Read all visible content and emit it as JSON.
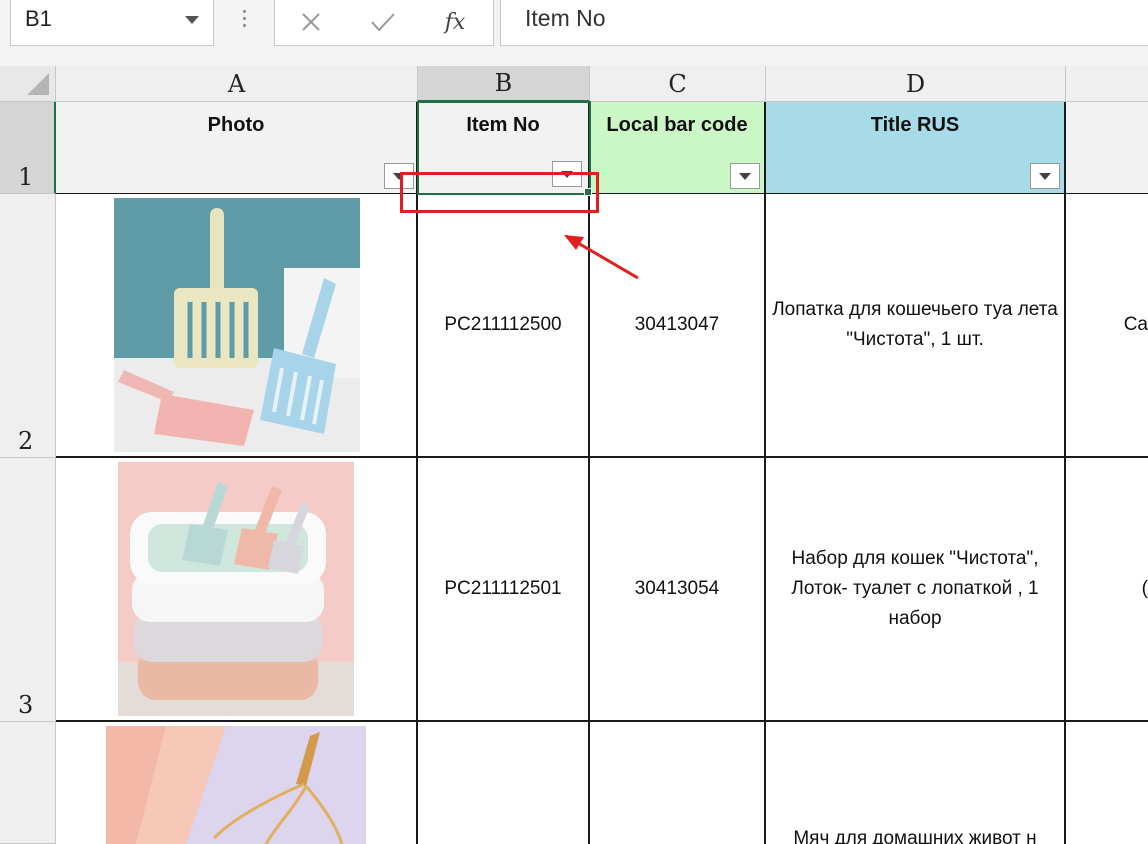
{
  "formula_bar": {
    "name_box": "B1",
    "formula": "Item No",
    "fx_label": "fx",
    "icons": [
      "cancel-x-icon",
      "confirm-check-icon",
      "insert-function-icon"
    ]
  },
  "columns": [
    "A",
    "B",
    "C",
    "D"
  ],
  "rows": [
    "1",
    "2",
    "3"
  ],
  "header": {
    "photo": "Photo",
    "item_no": "Item No",
    "local_bar_code": "Local bar code",
    "title_rus": "Title RUS"
  },
  "data_rows": [
    {
      "item_no": "PC211112500",
      "bar_code": "30413047",
      "title": "Лопатка для кошечьего туа лета \"Чистота\", 1 шт.",
      "partial": "Ca"
    },
    {
      "item_no": "PC211112501",
      "bar_code": "30413054",
      "title": "Набор для кошек \"Чистота\", Лоток- туалет с лопаткой , 1 набор",
      "partial": "("
    },
    {
      "title": "Мяч для домашних живот н"
    }
  ],
  "colors": {
    "bar_code_header_bg": "#cbf7c6",
    "title_header_bg": "#a8dbe8",
    "selection_green": "#1e7145",
    "annotation_red": "#e02020"
  }
}
